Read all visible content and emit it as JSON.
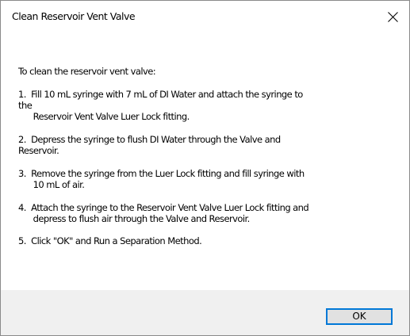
{
  "dialog": {
    "title": "Clean Reservoir Vent Valve",
    "close_icon": "close-icon",
    "intro": "To clean the reservoir vent valve:",
    "steps": [
      "1.  Fill 10 mL syringe with 7 mL of DI Water and attach the syringe to\nthe\n      Reservoir Vent Valve Luer Lock fitting.",
      "2.  Depress the syringe to flush DI Water through the Valve and\nReservoir.",
      "3.  Remove the syringe from the Luer Lock fitting and fill syringe with\n      10 mL of air.",
      "4.  Attach the syringe to the Reservoir Vent Valve Luer Lock fitting and\n      depress to flush air through the Valve and Reservoir.",
      "5.  Click \"OK\" and Run a Separation Method."
    ],
    "ok_label": "OK",
    "accent_color": "#0078d7",
    "footer_color": "#f0f0f0"
  }
}
